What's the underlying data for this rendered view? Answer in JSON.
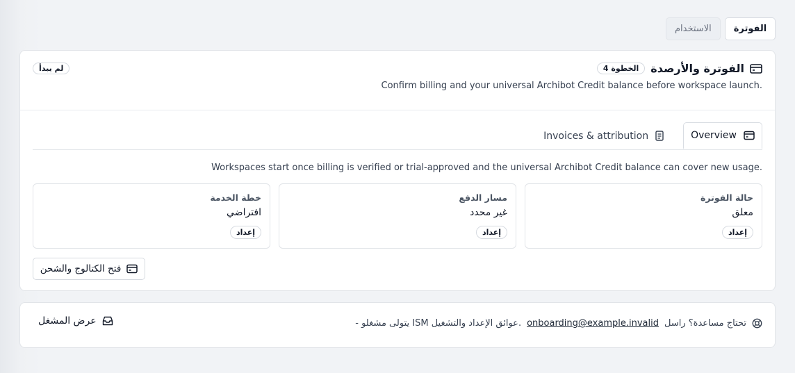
{
  "top_tabs": [
    {
      "label": "الفوترة",
      "active": true
    },
    {
      "label": "الاستخدام",
      "active": false
    }
  ],
  "card": {
    "title": "الفوترة والأرصدة",
    "step_badge": "الخطوة 4",
    "subtitle": "Confirm billing and your universal Archibot Credit balance before workspace launch.",
    "status_badge": "لم يبدأ"
  },
  "inner_tabs": [
    {
      "label": "Overview",
      "icon": "card-icon",
      "active": true
    },
    {
      "label": "Invoices & attribution",
      "icon": "document-icon",
      "active": false
    }
  ],
  "overview": {
    "note": "Workspaces start once billing is verified or trial-approved and the universal Archibot Credit balance can cover new usage."
  },
  "tiles": [
    {
      "label": "حالة الفوترة",
      "value": "معلق",
      "button": "إعداد"
    },
    {
      "label": "مسار الدفع",
      "value": "غير محدد",
      "button": "إعداد"
    },
    {
      "label": "خطة الخدمة",
      "value": "افتراضي",
      "button": "إعداد"
    }
  ],
  "catalog_button": {
    "label": "فتح الكتالوج والشحن",
    "icon": "card-icon"
  },
  "help": {
    "prefix": "تحتاج مساعدة؟ راسل",
    "email": "onboarding@example.invalid",
    "suffix": "- يتولى مشغلو ISM عوائق الإعداد والتشغيل.",
    "icon": "help-circle-icon",
    "operator_button": "عرض المشغل",
    "operator_icon": "inbox-icon"
  }
}
